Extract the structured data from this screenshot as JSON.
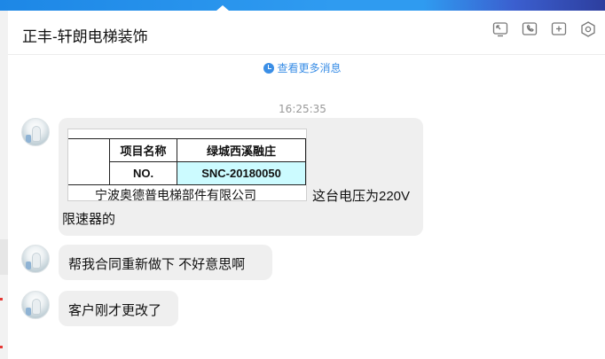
{
  "chat": {
    "title": "正丰-轩朗电梯装饰",
    "load_more": "查看更多消息",
    "timestamp": "16:25:35"
  },
  "header_icons": [
    "screen-share-icon",
    "phone-icon",
    "add-member-icon",
    "settings-icon"
  ],
  "messages": [
    {
      "image": {
        "header_label": "项目名称",
        "header_value": "绿城西溪融庄",
        "row_label": "NO.",
        "row_value": "SNC-20180050",
        "company": "宁波奥德普电梯部件有限公司",
        "highlight_color": "#ccfbff"
      },
      "text_line1": "这台电压为220V",
      "text_line2": "限速器的"
    },
    {
      "text": "帮我合同重新做下  不好意思啊"
    },
    {
      "text": "客户刚才更改了"
    }
  ],
  "colors": {
    "accent": "#3a8ee6",
    "bubble": "#efefef",
    "topbar": "#2f9bf0"
  }
}
